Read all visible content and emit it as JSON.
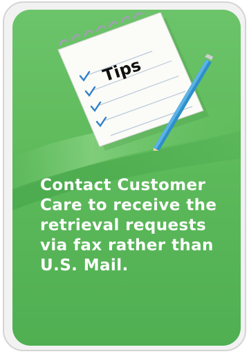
{
  "colors": {
    "card_green": "#5fbb5c",
    "text": "#ffffff",
    "pencil_blue": "#2f8fc9",
    "check_blue": "#2f7fc8"
  },
  "icons": {
    "notepad": "notepad-checklist-icon",
    "pencil": "pencil-icon"
  },
  "notepad": {
    "heading": "Tips"
  },
  "tip": {
    "lines": [
      "Contact Customer",
      "Care to receive the",
      "retrieval requests",
      "via fax rather than",
      "U.S. Mail."
    ]
  }
}
